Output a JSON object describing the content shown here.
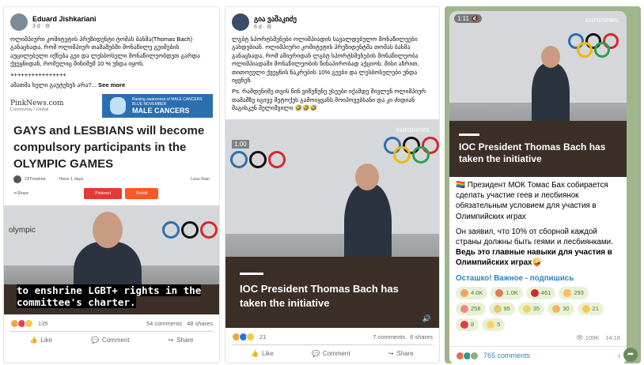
{
  "post1": {
    "author": "Eduard Jishkariani",
    "meta": "3 d · ⚙",
    "text": "ოლიმპიური კომიტეტის პრეზიდენტი ტომას ბახმა(Thomas Bach) განაცხადა, რომ ოლიმპიურ თამაშებში მონაწილე გეიმების აუცილებელი იქნება გეი და ლესბოსელი მონაწილეობდეთ გარდა ქვეყნიდან, რომელიც მინიმუმ 10 % უნდა იყოს.",
    "plus_line": "++++++++++++++++",
    "teaser": "ამათმა ხელი გაუტეხეს არა?...",
    "see_more": "See more",
    "site_logo": "PinkNews.com",
    "site_sub": "Community / Global",
    "ad_small": "Raising awareness of MALE CANCERS",
    "ad_blue": "BLUE NOVEMBER",
    "ad_big": "MALE CANCERS",
    "headline": "GAYS and LESBIANS will become compulsory participants in the OLYMPIC GAMES",
    "byline": "23Timeline",
    "time_ago": "· there 1 days",
    "less_than": "Less than",
    "share_label": "Share",
    "pinterest": "Pinterest",
    "reddit": "Reddit",
    "olympic_word": "olympic",
    "caption": "to enshrine LGBT+ rights in the committee's charter.",
    "reaction_count": "135",
    "comments": "54 comments",
    "shares": "48 shares",
    "like": "Like",
    "comment": "Comment",
    "share": "Share"
  },
  "post2": {
    "author": "გია ვაშაკიძე",
    "meta": "6 d · ⚙",
    "text": "ლგბტ სპორტსმენები ოლიმპიადის სავალდებულო მონაწილეები გახდებიან. ოლიმპიური კომიტეტის პრეზიდენტმა თომას ბახმა განაცხადა, რომ ამიერიდან ლგბტ სპორტსმენების მონაწილეობა ოლიმპიადაში მონაწილეობის წინაპირობად აქციოს. მისი აზრით, თითოეული ქვეყნის ნაკრების 10% გეები და ლესბოსელები უნდა იყვნენ.",
    "ps": "Ps. რამდენიმე თვის წინ ვიწუწუნე ესეები იქამდე მივლენ ოლიმპიურ თამაშზე იგივე მეტოქეს გამოიყვანს მოიპოვებსანი და კი ძიდიან მაგისკენ შელიშვილი 🤣🤣🤣",
    "time_code": "1.00",
    "euronews": "euronews.",
    "caption": "IOC President Thomas Bach has taken the initiative",
    "reaction_count": "21",
    "comments": "7 comments",
    "shares": "6 shares",
    "like": "Like",
    "comment": "Comment",
    "share": "Share"
  },
  "post3": {
    "video_time": "1:11 🔇",
    "euronews": "euronews.",
    "caption": "IOC President Thomas Bach has taken the initiative",
    "text1": "🏳️‍🌈 Президент МОК Томас Бах собирается сделать участие геев и лесбиянок обязательным условием для участия в Олимпийских играх",
    "text2a": "Он заявил, что 10% от сборной каждой страны должны быть геями и лесбиянками. ",
    "text2b": "Ведь это главные навыки для участия в Олимпийских играх🤪",
    "link": "Осташко! Важное - подпишись",
    "reactions": [
      {
        "count": "4.0K",
        "color": "#f4a259"
      },
      {
        "count": "1.0K",
        "color": "#e07a5f"
      },
      {
        "count": "461",
        "color": "#d62828"
      },
      {
        "count": "293",
        "color": "#f6bd60"
      },
      {
        "count": "258",
        "color": "#f28482"
      },
      {
        "count": "95",
        "color": "#e9c46a"
      },
      {
        "count": "35",
        "color": "#f4d35e"
      },
      {
        "count": "30",
        "color": "#f7b267"
      },
      {
        "count": "21",
        "color": "#f9c74f"
      },
      {
        "count": "8",
        "color": "#e63946"
      },
      {
        "count": "5",
        "color": "#ffd166"
      }
    ],
    "views": "👁 109K",
    "time": "14:18",
    "comments": "765 comments"
  }
}
